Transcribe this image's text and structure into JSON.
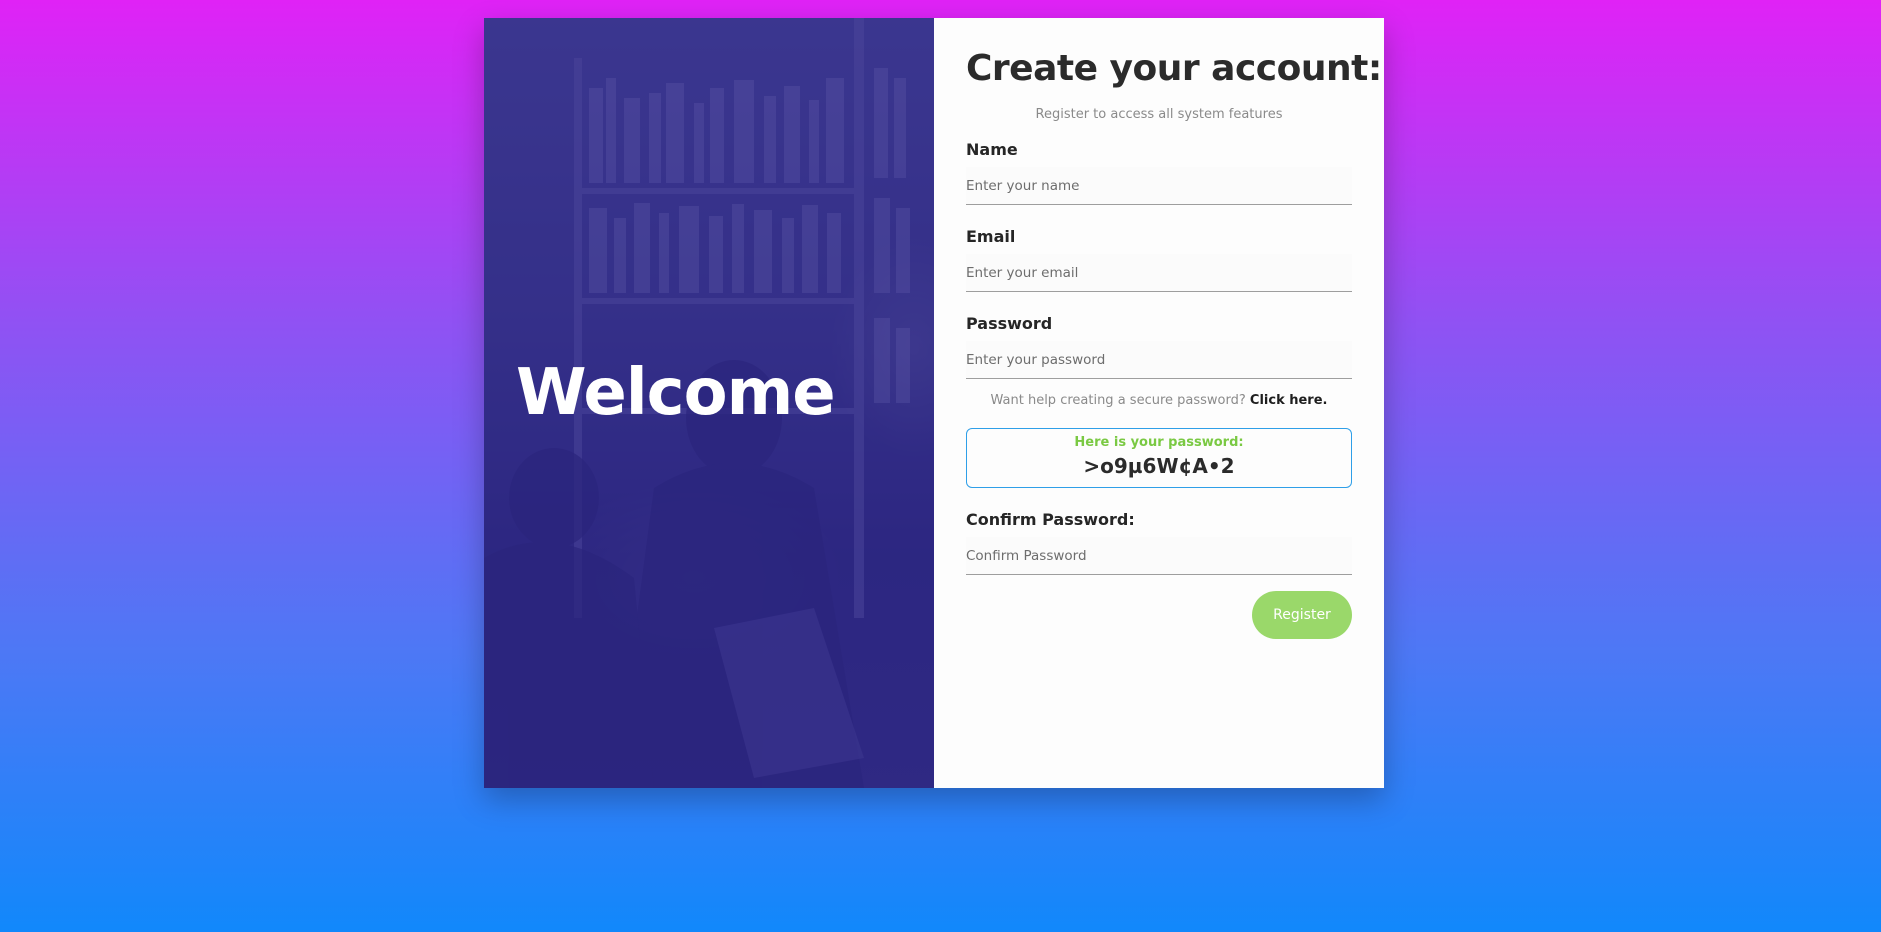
{
  "left_panel": {
    "heading": "Welcome"
  },
  "form": {
    "title": "Create your account:",
    "subtitle": "Register to access all system features",
    "fields": [
      {
        "label": "Name",
        "placeholder": "Enter your name",
        "value": ""
      },
      {
        "label": "Email",
        "placeholder": "Enter your email",
        "value": ""
      },
      {
        "label": "Password",
        "placeholder": "Enter your password",
        "value": ""
      }
    ],
    "help_text": "Want help creating a secure password?",
    "help_link": "Click here.",
    "generated_password": {
      "title": "Here is your password:",
      "value": ">o9µ6W¢A•2"
    },
    "confirm": {
      "label": "Confirm Password:",
      "placeholder": "Confirm Password",
      "value": ""
    },
    "register_label": "Register"
  },
  "colors": {
    "background_top": "#e022f6",
    "background_bottom": "#1188fb",
    "accent_green": "#9ad86a",
    "password_title_green": "#7ac943",
    "box_border_blue": "#2f9fe8"
  }
}
